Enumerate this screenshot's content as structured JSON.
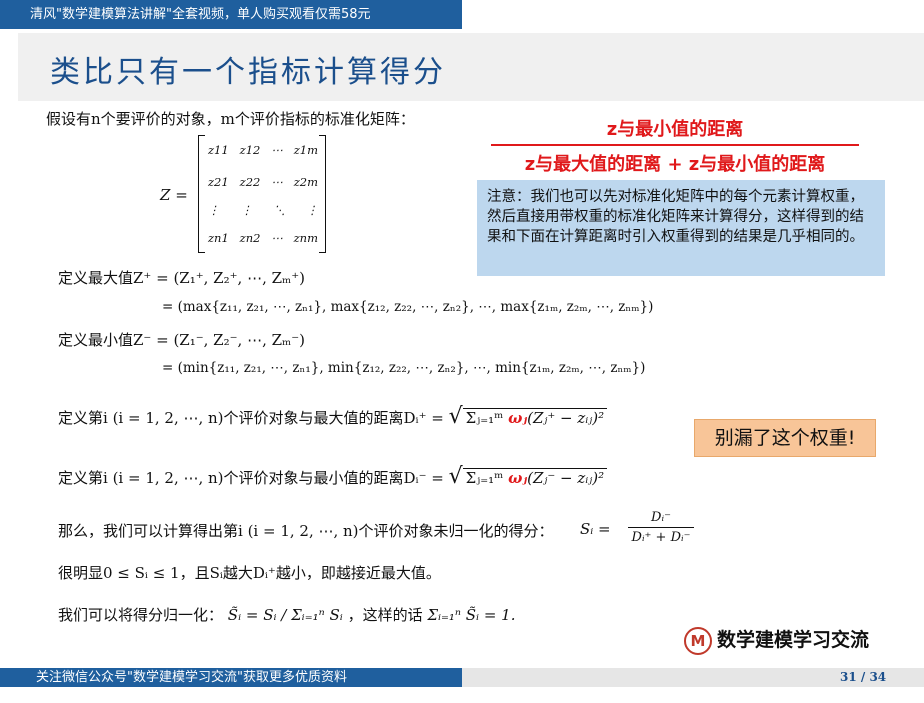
{
  "header": {
    "banner": "清风\"数学建模算法讲解\"全套视频，单人购买观看仅需58元",
    "title": "类比只有一个指标计算得分"
  },
  "body": {
    "intro": "假设有n个要评价的对象，m个评价指标的标准化矩阵：",
    "matrix_label": "Z =",
    "matrix_rows": [
      [
        "z11",
        "z12",
        "⋯",
        "z1m"
      ],
      [
        "z21",
        "z22",
        "⋯",
        "z2m"
      ],
      [
        "⋮",
        "⋮",
        "⋱",
        "⋮"
      ],
      [
        "zn1",
        "zn2",
        "⋯",
        "znm"
      ]
    ],
    "def_max_1": "定义最大值Z⁺ = (Z₁⁺, Z₂⁺, ⋯, Zₘ⁺)",
    "def_max_2": "= (max{z₁₁, z₂₁, ⋯, zₙ₁}, max{z₁₂, z₂₂, ⋯, zₙ₂}, ⋯, max{z₁ₘ, z₂ₘ, ⋯, zₙₘ})",
    "def_min_1": "定义最小值Z⁻ = (Z₁⁻, Z₂⁻, ⋯, Zₘ⁻)",
    "def_min_2": "= (min{z₁₁, z₂₁, ⋯, zₙ₁}, min{z₁₂, z₂₂, ⋯, zₙ₂}, ⋯, min{z₁ₘ, z₂ₘ, ⋯, zₙₘ})",
    "dist_max_prefix": "定义第i (i = 1, 2, ⋯, n)个评价对象与最大值的距离Dᵢ⁺ =",
    "dist_max_sum": "Σⱼ₌₁ᵐ",
    "dist_max_weight": "ωⱼ",
    "dist_max_rest": "(Zⱼ⁺ − zᵢⱼ)²",
    "dist_min_prefix": "定义第i (i = 1, 2, ⋯, n)个评价对象与最小值的距离Dᵢ⁻ =",
    "dist_min_sum": "Σⱼ₌₁ᵐ",
    "dist_min_weight": "ωⱼ",
    "dist_min_rest": "(Zⱼ⁻ − zᵢⱼ)²",
    "score_text": "那么，我们可以计算得出第i (i = 1, 2, ⋯, n)个评价对象未归一化的得分：",
    "score_lhs": "Sᵢ =",
    "score_num": "Dᵢ⁻",
    "score_den": "Dᵢ⁺ + Dᵢ⁻",
    "obvious": "很明显0 ≤ Sᵢ ≤ 1，且Sᵢ越大Dᵢ⁺越小，即越接近最大值。",
    "normalize_prefix": "我们可以将得分归一化：",
    "normalize_formula": "S̃ᵢ = Sᵢ / Σᵢ₌₁ⁿ Sᵢ",
    "normalize_mid": "，这样的话",
    "normalize_formula2": "Σᵢ₌₁ⁿ S̃ᵢ = 1."
  },
  "callouts": {
    "fraction_num": "z与最小值的距离",
    "fraction_den": "z与最大值的距离 + z与最小值的距离",
    "note": "注意：我们也可以先对标准化矩阵中的每个元素计算权重，然后直接用带权重的标准化矩阵来计算得分，这样得到的结果和下面在计算距离时引入权重得到的结果是几乎相同的。",
    "warning": "别漏了这个权重!"
  },
  "logo": {
    "mark": "M",
    "text": "数学建模学习交流"
  },
  "footer": {
    "left": "关注微信公众号\"数学建模学习交流\"获取更多优质资料",
    "page": "31 / 34"
  },
  "colors": {
    "brand_blue": "#1f5f9e",
    "accent_red": "#e0191b",
    "note_bg": "#bdd7ee",
    "warn_bg": "#f8c598"
  }
}
